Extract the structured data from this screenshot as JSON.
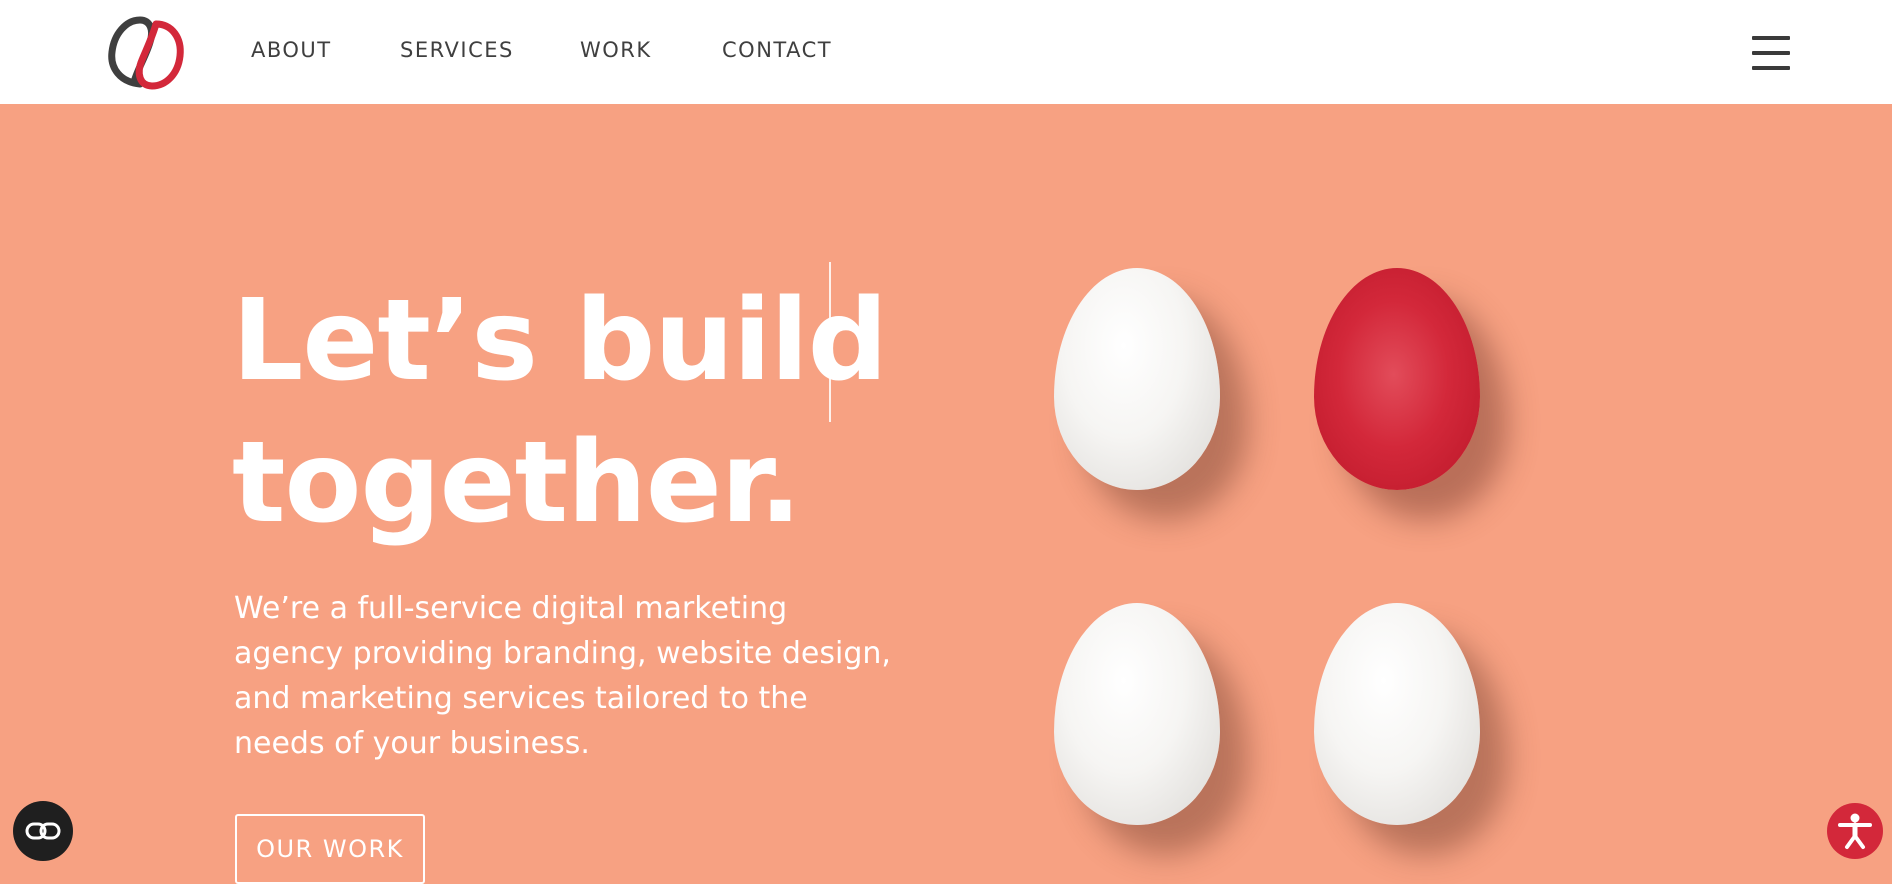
{
  "nav": {
    "items": [
      {
        "label": "ABOUT"
      },
      {
        "label": "SERVICES"
      },
      {
        "label": "WORK"
      },
      {
        "label": "CONTACT"
      }
    ]
  },
  "hero": {
    "headline_line1": "Let’s build",
    "headline_line2": "together.",
    "subcopy": "We’re a full-service digital marketing agency providing branding, website design, and marketing services tailored to the needs of your business.",
    "cta_label": "OUR WORK"
  },
  "icons": {
    "logo": "brand-logo-interlocking-loops",
    "menu": "hamburger-menu-icon",
    "accessibility_toggle": "link-icon",
    "accessibility_widget": "accessibility-person-icon"
  },
  "colors": {
    "hero_background": "#f7a182",
    "brand_red": "#d3283a",
    "brand_gray": "#3f3f3f",
    "nav_text": "#3f3f3f",
    "white": "#ffffff"
  }
}
